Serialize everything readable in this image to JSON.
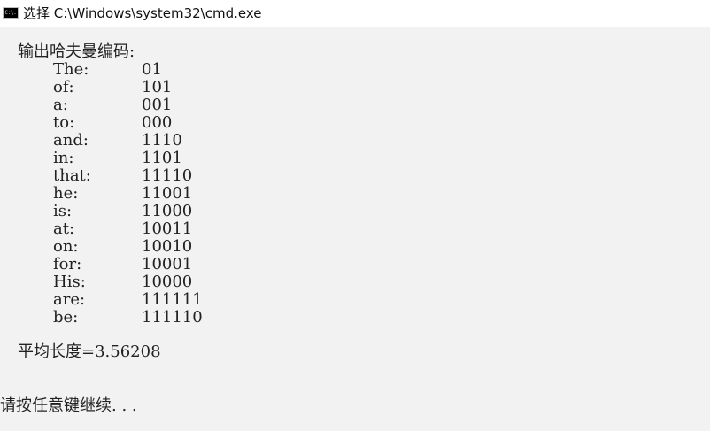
{
  "window": {
    "title": "选择 C:\\Windows\\system32\\cmd.exe",
    "icon_text": "C:\\."
  },
  "console": {
    "heading": "输出哈夫曼编码:",
    "codes": [
      {
        "word": "The:",
        "code": "01"
      },
      {
        "word": "of:",
        "code": "101"
      },
      {
        "word": "a:",
        "code": "001"
      },
      {
        "word": "to:",
        "code": "000"
      },
      {
        "word": "and:",
        "code": "1110"
      },
      {
        "word": "in:",
        "code": "1101"
      },
      {
        "word": "that:",
        "code": "11110"
      },
      {
        "word": "he:",
        "code": "11001"
      },
      {
        "word": "is:",
        "code": "11000"
      },
      {
        "word": "at:",
        "code": "10011"
      },
      {
        "word": "on:",
        "code": "10010"
      },
      {
        "word": "for:",
        "code": "10001"
      },
      {
        "word": "His:",
        "code": "10000"
      },
      {
        "word": "are:",
        "code": "111111"
      },
      {
        "word": "be:",
        "code": "111110"
      }
    ],
    "average": "平均长度=3.56208",
    "pause_prompt": "请按任意键继续. . ."
  }
}
